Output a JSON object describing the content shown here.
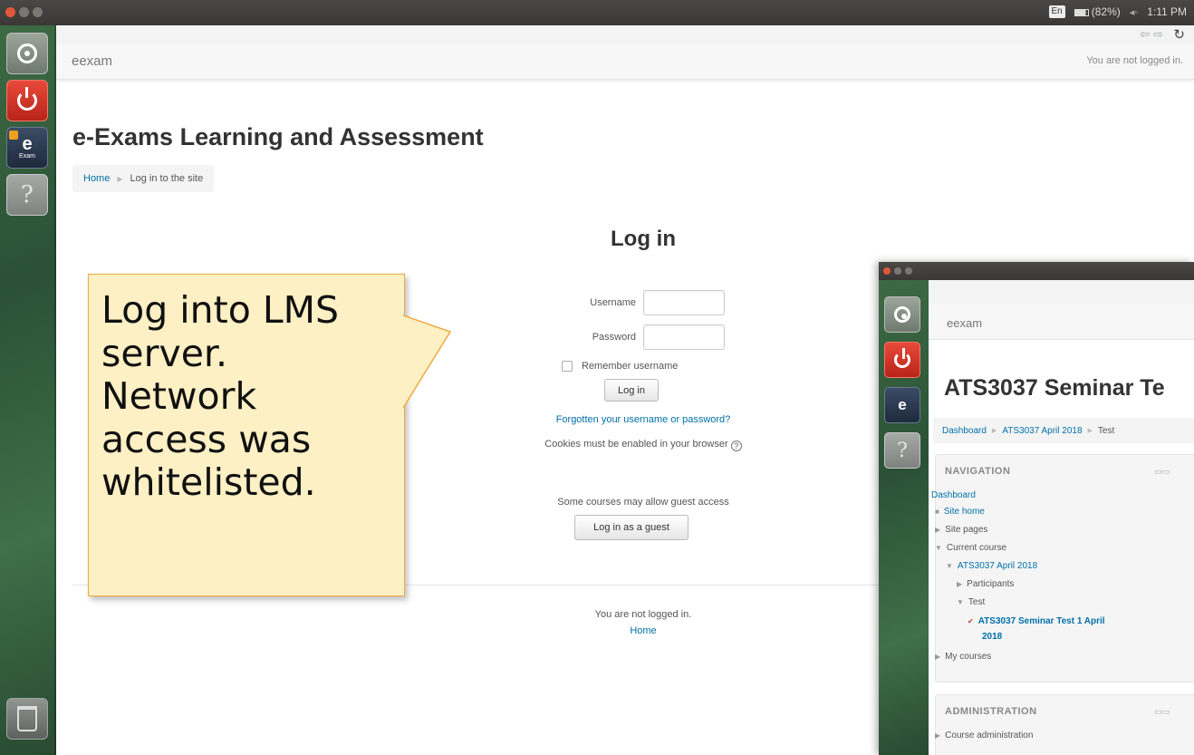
{
  "system_bar": {
    "lang": "En",
    "battery": "(82%)",
    "time": "1:11 PM"
  },
  "browser": {
    "brand": "eexam",
    "login_status": "You are not logged in."
  },
  "page": {
    "site_title": "e-Exams Learning and Assessment",
    "breadcrumb": [
      "Home",
      "Log in to the site"
    ],
    "login_title": "Log in",
    "username_label": "Username",
    "password_label": "Password",
    "remember_label": "Remember username",
    "login_button": "Log in",
    "forgot_link": "Forgotten your username or password?",
    "cookies_text": "Cookies must be enabled in your browser",
    "guest_note": "Some courses may allow guest access",
    "guest_button": "Log in as a guest",
    "footer_status": "You are not logged in.",
    "footer_home": "Home"
  },
  "callout": {
    "lines": [
      "Log into LMS",
      "server.",
      "Network",
      "access was",
      "whitelisted."
    ]
  },
  "second_screen": {
    "brand": "eexam",
    "title": "ATS3037 Seminar Te",
    "breadcrumb": [
      "Dashboard",
      "ATS3037 April 2018",
      "Test"
    ],
    "navigation": {
      "title": "NAVIGATION",
      "dashboard": "Dashboard",
      "site_home": "Site home",
      "site_pages": "Site pages",
      "current_course": "Current course",
      "course": "ATS3037 April 2018",
      "participants": "Participants",
      "test": "Test",
      "quiz_line1": "ATS3037 Seminar Test 1 April",
      "quiz_line2": "2018",
      "my_courses": "My courses"
    },
    "administration": {
      "title": "ADMINISTRATION",
      "course_admin": "Course administration"
    }
  }
}
